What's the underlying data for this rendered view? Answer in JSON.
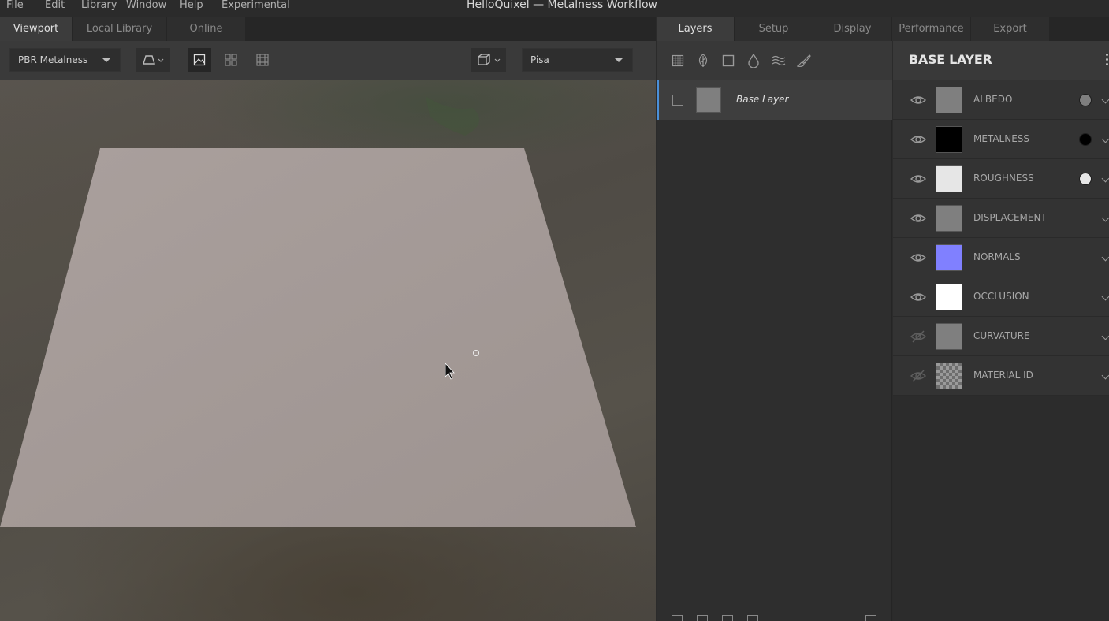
{
  "window": {
    "title": "HelloQuixel — Metalness Workflow"
  },
  "menu": [
    "File",
    "Edit",
    "Library",
    "Window",
    "Help",
    "Experimental"
  ],
  "left_tabs": [
    {
      "label": "Viewport",
      "active": true
    },
    {
      "label": "Local Library",
      "active": false
    },
    {
      "label": "Online",
      "active": false
    }
  ],
  "toolbar": {
    "workflow_select": "PBR Metalness",
    "environment_select": "Pisa",
    "icons": [
      "perspective-camera-icon",
      "image-view-icon",
      "grid-4-icon",
      "grid-9-icon",
      "cube-view-icon"
    ]
  },
  "viewport": {
    "plane_color": "#a09693",
    "background_colors": [
      "#5a5650",
      "#4a4640"
    ]
  },
  "right_tabs": [
    {
      "label": "Layers",
      "active": true
    },
    {
      "label": "Setup",
      "active": false
    },
    {
      "label": "Display",
      "active": false
    },
    {
      "label": "Performance",
      "active": false
    },
    {
      "label": "Export",
      "active": false
    }
  ],
  "layers": {
    "tool_icons": [
      "smart-material-icon",
      "leaf-icon",
      "square-layer-icon",
      "drop-icon",
      "waves-icon",
      "paint-brush-icon"
    ],
    "items": [
      {
        "name": "Base Layer",
        "thumb_color": "#7f7f7f",
        "selected": true
      }
    ]
  },
  "channels": {
    "title": "BASE LAYER",
    "items": [
      {
        "label": "ALBEDO",
        "thumb": "#7f7f7f",
        "visible": true,
        "dot": "#7f7f7f"
      },
      {
        "label": "METALNESS",
        "thumb": "#000000",
        "visible": true,
        "dot": "#000000"
      },
      {
        "label": "ROUGHNESS",
        "thumb": "#e6e6e6",
        "visible": true,
        "dot": "#e6e6e6"
      },
      {
        "label": "DISPLACEMENT",
        "thumb": "#7f7f7f",
        "visible": true,
        "dot": null
      },
      {
        "label": "NORMALS",
        "thumb": "#8080ff",
        "visible": true,
        "dot": null
      },
      {
        "label": "OCCLUSION",
        "thumb": "#ffffff",
        "visible": true,
        "dot": null
      },
      {
        "label": "CURVATURE",
        "thumb": "#7f7f7f",
        "visible": false,
        "dot": null
      },
      {
        "label": "MATERIAL ID",
        "thumb": "checker",
        "visible": false,
        "dot": null
      }
    ]
  },
  "accent_color": "#4a90d9"
}
